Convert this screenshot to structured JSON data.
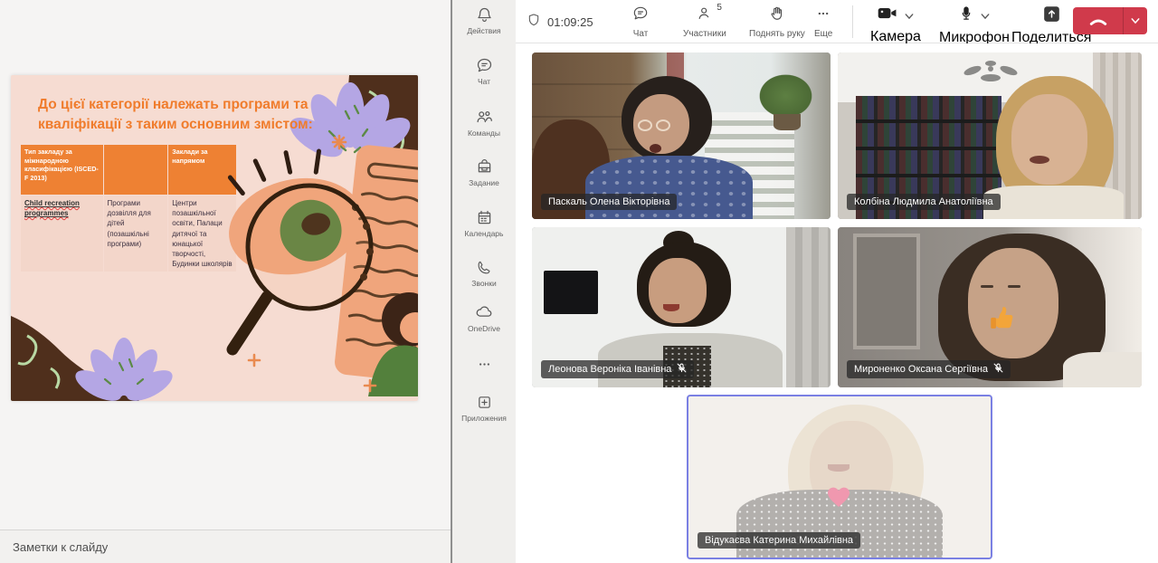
{
  "presentation": {
    "slide": {
      "title": "До цієї категорії належать програми та кваліфікації з таким основним змістом:",
      "table": {
        "headers": [
          "Тип закладу за міжнародною класифікацією (ISCED-F 2013)",
          "",
          "Заклади за напрямом"
        ],
        "row": [
          "Child recreation programmes",
          "Програми дозвілля для дітей (позашкільні програми)",
          "Центри позашкільної освіти, Палаци дитячої та юнацької творчості, Будинки школярів"
        ]
      }
    },
    "notes_label": "Заметки к слайду"
  },
  "sidebar": {
    "items": [
      {
        "label": "Действия",
        "icon": "bell-icon"
      },
      {
        "label": "Чат",
        "icon": "chat-icon"
      },
      {
        "label": "Команды",
        "icon": "teams-icon"
      },
      {
        "label": "Задание",
        "icon": "assignments-icon"
      },
      {
        "label": "Календарь",
        "icon": "calendar-icon"
      },
      {
        "label": "Звонки",
        "icon": "calls-icon"
      },
      {
        "label": "OneDrive",
        "icon": "onedrive-cloud-icon"
      },
      {
        "label": "",
        "icon": "more-icon"
      },
      {
        "label": "Приложения",
        "icon": "apps-icon"
      }
    ]
  },
  "meeting": {
    "toolbar": {
      "timer": "01:09:25",
      "chat": "Чат",
      "participants": "Участники",
      "participants_count": "5",
      "raise_hand": "Поднять руку",
      "more": "Еще",
      "camera": "Камера",
      "microphone": "Микрофон",
      "share": "Поделиться"
    }
  },
  "participants": [
    {
      "name": "Паскаль Олена Вікторівна",
      "muted": false
    },
    {
      "name": "Колбіна Людмила Анатоліївна",
      "muted": false
    },
    {
      "name": "Леонова Вероніка Іванівна",
      "muted": true
    },
    {
      "name": "Мироненко Оксана Сергіївна",
      "muted": true,
      "reaction": "thumbs-up"
    },
    {
      "name": "Відукаєва Катерина Михайлівна",
      "muted": false,
      "reaction": "heart",
      "active_speaker": true
    }
  ],
  "colors": {
    "hangup_red": "#d03a4b",
    "active_speaker_border": "#7a80e3",
    "slide_accent_orange": "#f07c2c",
    "slide_background_pink": "#f6dcd2",
    "table_header_orange": "#ee8133"
  }
}
